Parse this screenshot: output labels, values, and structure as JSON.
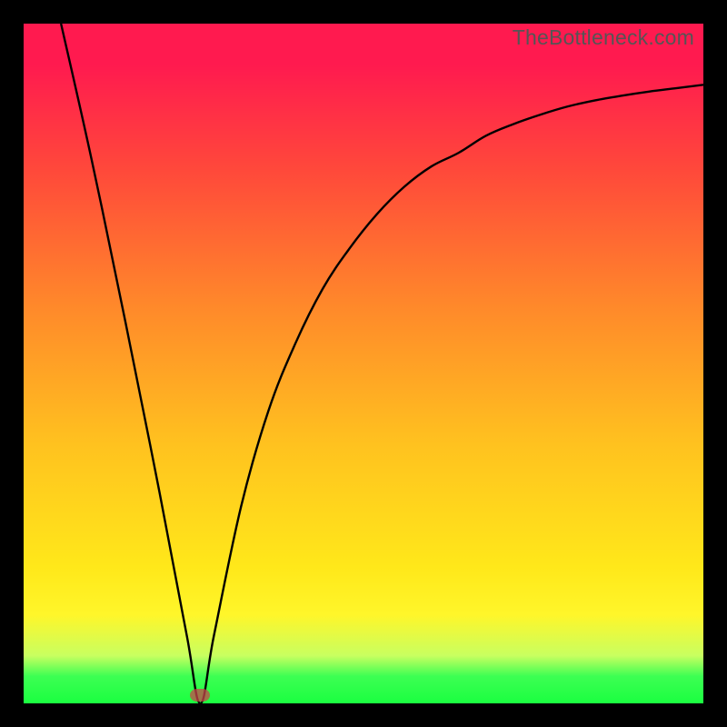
{
  "attribution": "TheBottleneck.com",
  "marker": {
    "x_frac": 0.26,
    "y_frac": 0.988
  },
  "chart_data": {
    "type": "line",
    "title": "",
    "xlabel": "",
    "ylabel": "",
    "xlim": [
      0,
      1
    ],
    "ylim": [
      0,
      1
    ],
    "series": [
      {
        "name": "curve",
        "x": [
          0.055,
          0.1,
          0.15,
          0.2,
          0.24,
          0.26,
          0.28,
          0.32,
          0.36,
          0.4,
          0.44,
          0.48,
          0.52,
          0.56,
          0.6,
          0.64,
          0.68,
          0.72,
          0.76,
          0.8,
          0.84,
          0.88,
          0.92,
          0.96,
          1.0
        ],
        "y": [
          1.0,
          0.8,
          0.56,
          0.31,
          0.1,
          0.0,
          0.1,
          0.29,
          0.43,
          0.53,
          0.61,
          0.67,
          0.72,
          0.76,
          0.79,
          0.81,
          0.835,
          0.852,
          0.866,
          0.878,
          0.887,
          0.894,
          0.9,
          0.905,
          0.91
        ]
      }
    ]
  },
  "colors": {
    "gradient_top": "#ff1a4f",
    "gradient_mid": "#ffc21f",
    "gradient_bottom": "#1aff40",
    "curve": "#000000",
    "frame_bg": "#000000"
  }
}
